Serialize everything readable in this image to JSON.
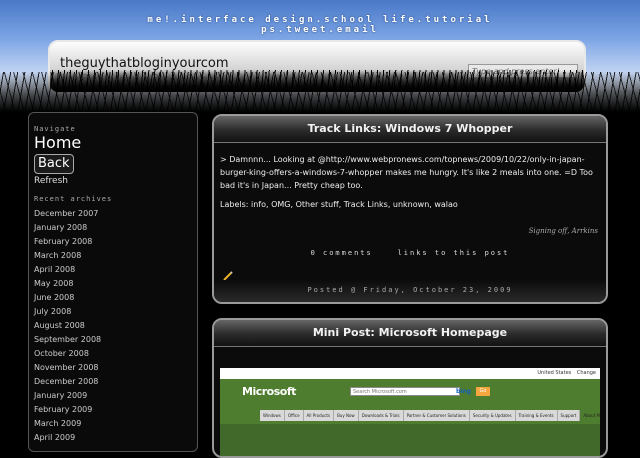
{
  "header": {
    "topnav": "me!.interface design.school life.tutorial ps.tweet.email",
    "site_title": "theguythatbloginyourcom",
    "search_placeholder": "Type and press enter!"
  },
  "sidebar": {
    "navigate_heading": "Navigate",
    "home_label": "Home",
    "back_label": "Back",
    "refresh_label": "Refresh",
    "archives_heading": "Recent archives",
    "archives": [
      "December 2007",
      "January 2008",
      "February 2008",
      "March 2008",
      "April 2008",
      "May 2008",
      "June 2008",
      "July 2008",
      "August 2008",
      "September 2008",
      "October 2008",
      "November 2008",
      "December 2008",
      "January 2009",
      "February 2009",
      "March 2009",
      "April 2009"
    ]
  },
  "posts": [
    {
      "title": "Track Links: Windows 7 Whopper",
      "body": "> Damnnn... Looking at @http://www.webpronews.com/topnews/2009/10/22/only-in-japan-burger-king-offers-a-windows-7-whopper makes me hungry. It's like 2 meals into one. =D Too bad it's in Japan... Pretty cheap too.",
      "labels": "Labels: info, OMG, Other stuff, Track Links, unknown, walao",
      "signoff": "Signing off, Arrkins",
      "comments": "0 comments",
      "links": "links to this post",
      "posted": "Posted @ Friday, October 23, 2009"
    },
    {
      "title": "Mini Post: Microsoft Homepage",
      "screenshot": {
        "region": "United States",
        "change": "Change",
        "logo": "Microsoft",
        "search_placeholder": "Search Microsoft.com",
        "search_engine": "bing",
        "go": "Go",
        "nav": [
          "Windows",
          "Office",
          "All Products",
          "Buy Now",
          "Downloads & Trials",
          "Partner & Customer Solutions",
          "Security & Updates",
          "Training & Events",
          "Support",
          "About Microsoft"
        ]
      }
    }
  ],
  "colors": {
    "accent": "#e89a2c",
    "background": "#000000",
    "post_border": "#9a9a9a"
  }
}
